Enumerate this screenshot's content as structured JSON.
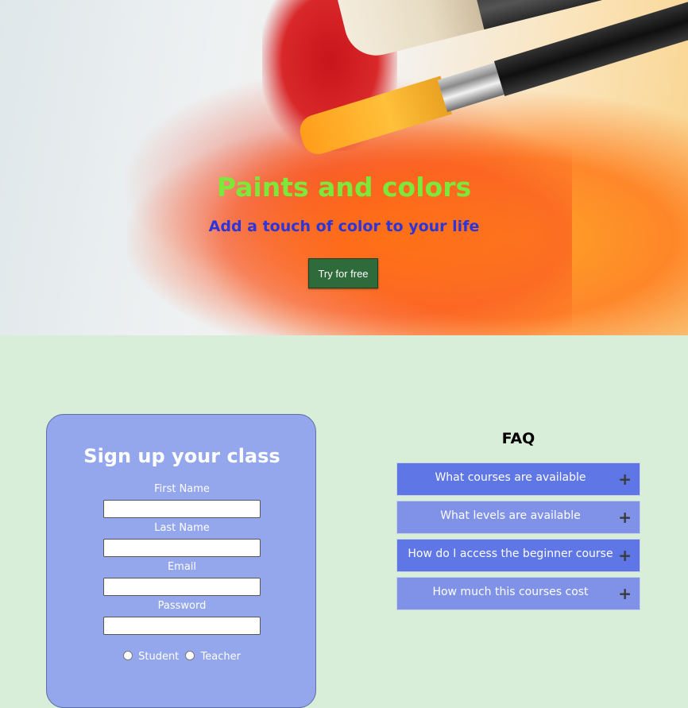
{
  "hero": {
    "title": "Paints and colors",
    "subtitle": "Add a touch of color to your life",
    "cta_label": "Try for free",
    "colors": {
      "title": "#7be83a",
      "subtitle": "#2b35d9",
      "cta_bg": "#2f6b3a"
    }
  },
  "signup": {
    "title": "Sign up your class",
    "fields": [
      {
        "label": "First Name",
        "value": ""
      },
      {
        "label": "Last Name",
        "value": ""
      },
      {
        "label": "Email",
        "value": ""
      },
      {
        "label": "Password",
        "value": ""
      }
    ],
    "roles": [
      {
        "label": "Student",
        "selected": false
      },
      {
        "label": "Teacher",
        "selected": false
      }
    ],
    "colors": {
      "card_bg": "#94a6ec"
    }
  },
  "faq": {
    "title": "FAQ",
    "items": [
      {
        "question": "What courses are available",
        "icon": "plus-icon",
        "glyph": "+"
      },
      {
        "question": "What levels are available",
        "icon": "plus-icon",
        "glyph": "+"
      },
      {
        "question": "How do I access the beginner course",
        "icon": "plus-icon",
        "glyph": "+"
      },
      {
        "question": "How much this courses cost",
        "icon": "plus-icon",
        "glyph": "+"
      }
    ],
    "colors": {
      "item_dark": "#5e76e6",
      "item_light": "#7f92e8"
    }
  },
  "page": {
    "background": "#d9eed8"
  }
}
